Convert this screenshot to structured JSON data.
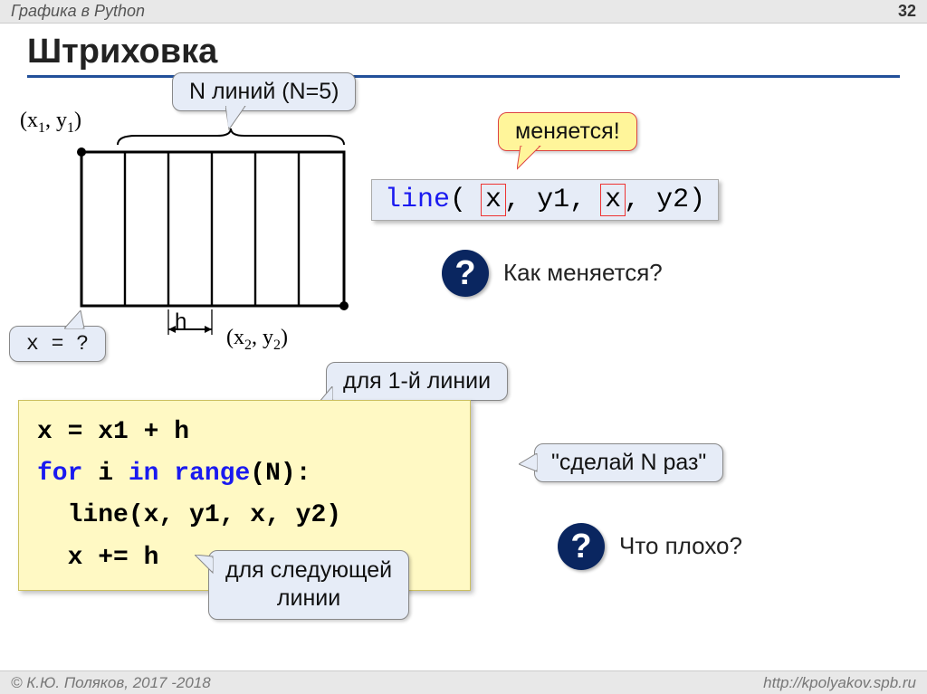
{
  "header": {
    "subject": "Графика в Python",
    "page": "32"
  },
  "footer": {
    "copyright": "© К.Ю. Поляков, 2017 -2018",
    "url": "http://kpolyakov.spb.ru"
  },
  "title": "Штриховка",
  "callouts": {
    "nlines": "N линий (N=5)",
    "xq": "x = ?",
    "changes": "меняется!",
    "first_line": "для 1-й линии",
    "do_n": "\"сделай N раз\"",
    "next_line": "для следующей\nлинии"
  },
  "coords": {
    "tl_pre": "(x",
    "tl_sub1": "1",
    "tl_mid": ", y",
    "tl_sub2": "1",
    "tl_post": ")",
    "br_pre": "(x",
    "br_sub1": "2",
    "br_mid": ", y",
    "br_sub2": "2",
    "br_post": ")",
    "h": "h"
  },
  "codebar": {
    "fn": "line",
    "p1": "(",
    "x1": "x",
    "c1": ", y1, ",
    "x2": "x",
    "c2": ", y2)"
  },
  "q1": "Как меняется?",
  "q2": "Что плохо?",
  "code": {
    "l1a": "x = x1 + h",
    "l2a": "for",
    "l2b": " i ",
    "l2c": "in",
    "l2d": " ",
    "l2e": "range",
    "l2f": "(N):",
    "l3": "  line(x, y1, x, y2)",
    "l4": "  x += h"
  }
}
